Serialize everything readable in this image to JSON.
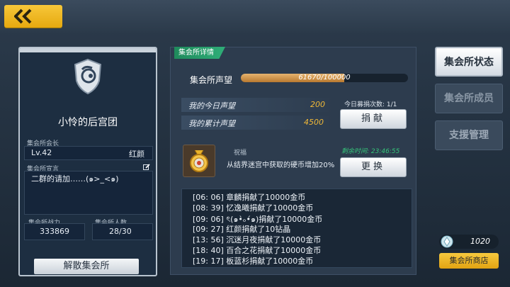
{
  "colors": {
    "accent_yellow": "#f1b938",
    "accent_green": "#2fae78",
    "panel_dark": "#1d2e41"
  },
  "guild": {
    "name": "小怜的后宫团",
    "leader_label": "集会所会长",
    "leader_level": "Lv.42",
    "leader_name": "红颜",
    "motto_label": "集会所宣言",
    "motto": "二群的请加……(๑>_<๑)",
    "power_label": "集会所战力",
    "power_value": "333869",
    "members_label": "集会所人数",
    "members_value": "28/30",
    "disband_label": "解散集会所"
  },
  "detail": {
    "tab_label": "集会所详情",
    "reputation_label": "集会所声望",
    "reputation_text": "61670/100000",
    "reputation_current": 61670,
    "reputation_max": 100000,
    "today_label": "我的今日声望",
    "today_value": "200",
    "total_label": "我的累计声望",
    "total_value": "4500",
    "donate_count": "今日募捐次数: 1/1",
    "donate_label": "捐献",
    "blessing_title": "祝福",
    "blessing_desc": "从结界迷宫中获取的硬币增加20%",
    "remain_time": "剩余时间: 23:46:55",
    "change_label": "更换",
    "log": [
      "[06: 06] 章麟捐献了10000金币",
      "[08: 39] 忆逸曦捐献了10000金币",
      "[09: 06] ৎ(๑•̀ₒ•́๑)捐献了10000金币",
      "[09: 27] 红颜捐献了10钻晶",
      "[13: 56] 沉迷月夜捐献了10000金币",
      "[18: 40] 百合之花捐献了10000金币",
      "[19: 17] 板蓝杉捐献了10000金币"
    ]
  },
  "sidebar": {
    "tabs": [
      {
        "label": "集会所状态"
      },
      {
        "label": "集会所成员"
      },
      {
        "label": "支援管理"
      }
    ],
    "currency_value": "1020",
    "shop_label": "集会所商店"
  },
  "icons": [
    "back-arrow-icon",
    "guild-emblem-icon",
    "edit-icon",
    "blessing-medal-icon",
    "gem-icon"
  ]
}
